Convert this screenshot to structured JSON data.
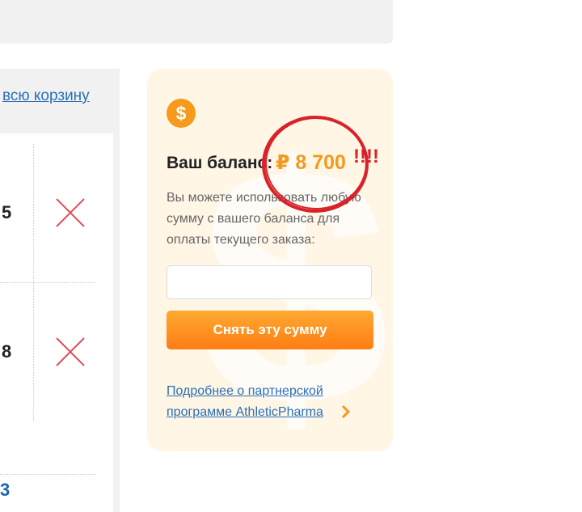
{
  "cart": {
    "clear_link": "всю корзину",
    "rows": [
      {
        "qty": "5"
      },
      {
        "qty": "8"
      }
    ],
    "total": "3"
  },
  "balance": {
    "label": "Ваш баланс:",
    "amount": "₽ 8 700",
    "annotation": "!!!!",
    "description": "Вы можете использовать любую сумму с вашего баланса для оплаты текущего заказа:",
    "input_placeholder": "",
    "button_label": "Снять эту сумму",
    "partner_link": "Подробнее о партнерской программе AthleticPharma"
  },
  "icons": {
    "coin": "dollar-coin-icon",
    "remove": "cross-icon",
    "chevron": "chevron-right-icon",
    "watermark": "dollar-watermark-icon"
  },
  "colors": {
    "accent_orange": "#f39a1e",
    "link_blue": "#2a6fb8",
    "annotation_red": "#d8232a",
    "card_bg": "#fff6e6"
  }
}
